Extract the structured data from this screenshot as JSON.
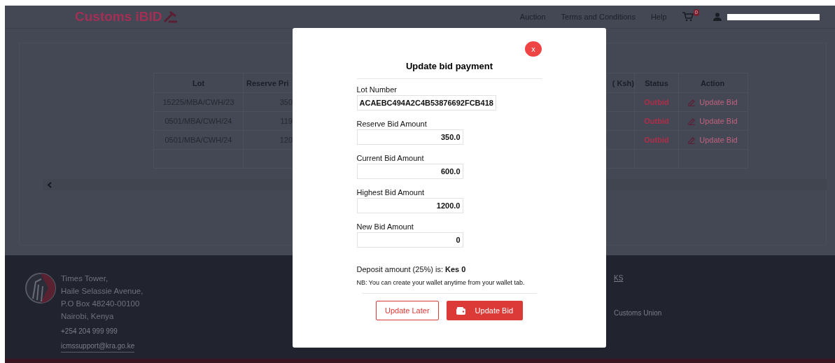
{
  "header": {
    "logo": "Customs iBID",
    "nav": [
      "Auction",
      "Terms and Conditions",
      "Help"
    ],
    "cart_badge": "0"
  },
  "table": {
    "columns": [
      "Lot",
      "Reserve Pri",
      "( Ksh)",
      "Status",
      "Action"
    ],
    "rows": [
      {
        "lot": "15225/MBA/CWH/23",
        "reserve": "350",
        "status": "Outbid",
        "action": "Update Bid"
      },
      {
        "lot": "0501/MBA/CWH/24",
        "reserve": "119",
        "status": "Outbid",
        "action": "Update Bid"
      },
      {
        "lot": "0501/MBA/CWH/24",
        "reserve": "120",
        "status": "Outbid",
        "action": "Update Bid"
      }
    ]
  },
  "footer": {
    "address": [
      "Times Tower,",
      "Haile Selassie Avenue,",
      "P.O Box 48240-00100",
      "Nairobi, Kenya"
    ],
    "phone": "+254 204 999 999",
    "email": "icmssupport@kra.go.ke",
    "links": [
      "KS",
      "Customs Union"
    ]
  },
  "modal": {
    "close": "x",
    "title": "Update bid payment",
    "fields": [
      {
        "label": "Lot Number",
        "value": "ACAEBC494A2C4B53876692FCB418",
        "kind": "wide"
      },
      {
        "label": "Reserve Bid Amount",
        "value": "350.0",
        "kind": "amount"
      },
      {
        "label": "Current Bid Amount",
        "value": "600.0",
        "kind": "amount"
      },
      {
        "label": "Highest Bid Amount",
        "value": "1200.0",
        "kind": "amount"
      },
      {
        "label": "New Bid Amount",
        "value": "0",
        "kind": "amount"
      }
    ],
    "deposit": "Deposit amount (25%) is: **Kes 0**",
    "note": "NB: You can create your wallet anytime from your wallet tab.",
    "buttons": [
      {
        "label": "Update Later",
        "kind": "outline"
      },
      {
        "label": "Update Bid",
        "kind": "primary"
      }
    ]
  }
}
